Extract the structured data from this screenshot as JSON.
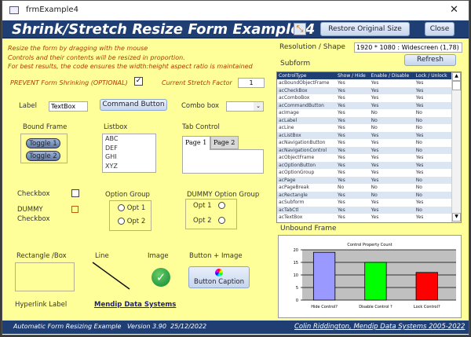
{
  "window": {
    "title": "frmExample4",
    "close_glyph": "✕"
  },
  "header": {
    "title": "Shrink/Stretch Resize Form Example 4",
    "restore_label": "Restore Original Size",
    "close_label": "Close"
  },
  "instructions": [
    "Resize the form by dragging with the mouse",
    "Controls and their contents will be resized in proportion.",
    "For best results, the code ensures the width:height aspect ratio is maintained"
  ],
  "prevent": {
    "label": "PREVENT Form Shrinking (OPTIONAL)",
    "checked": true
  },
  "stretch": {
    "label": "Current Stretch Factor",
    "value": "1"
  },
  "resolution": {
    "label": "Resolution / Shape",
    "value": "1920 * 1080 : Widescreen (1,78)"
  },
  "refresh_label": "Refresh",
  "subform": {
    "label": "Subform",
    "columns": [
      "ControlType",
      "Show / Hide",
      "Enable / Disable",
      "Lock / Unlock"
    ],
    "rows": [
      [
        "acBoundObjectFrame",
        "Yes",
        "Yes",
        "Yes"
      ],
      [
        "acCheckBox",
        "Yes",
        "Yes",
        "Yes"
      ],
      [
        "acComboBox",
        "Yes",
        "Yes",
        "Yes"
      ],
      [
        "acCommandButton",
        "Yes",
        "Yes",
        "Yes"
      ],
      [
        "acImage",
        "Yes",
        "No",
        "No"
      ],
      [
        "acLabel",
        "Yes",
        "No",
        "No"
      ],
      [
        "acLine",
        "Yes",
        "No",
        "No"
      ],
      [
        "acListBox",
        "Yes",
        "Yes",
        "Yes"
      ],
      [
        "acNavigationButton",
        "Yes",
        "Yes",
        "No"
      ],
      [
        "acNavigationControl",
        "Yes",
        "Yes",
        "No"
      ],
      [
        "acObjectFrame",
        "Yes",
        "Yes",
        "Yes"
      ],
      [
        "acOptionButton",
        "Yes",
        "Yes",
        "Yes"
      ],
      [
        "acOptionGroup",
        "Yes",
        "Yes",
        "Yes"
      ],
      [
        "acPage",
        "Yes",
        "Yes",
        "No"
      ],
      [
        "acPageBreak",
        "No",
        "No",
        "No"
      ],
      [
        "acRectangle",
        "Yes",
        "No",
        "No"
      ],
      [
        "acSubform",
        "Yes",
        "Yes",
        "Yes"
      ],
      [
        "acTabCtl",
        "Yes",
        "Yes",
        "No"
      ],
      [
        "acTextBox",
        "Yes",
        "Yes",
        "Yes"
      ]
    ]
  },
  "controls": {
    "label": "Label",
    "textbox": "TextBox",
    "command": "Command Button",
    "combo_label": "Combo box",
    "bound_frame": "Bound Frame",
    "toggle1": "Toggle 1",
    "toggle2": "Toggle 2",
    "listbox_label": "Listbox",
    "listbox_items": [
      "ABC",
      "DEF",
      "GHI",
      "XYZ"
    ],
    "tab_label": "Tab Control",
    "tab1": "Page 1",
    "tab2": "Page 2",
    "checkbox": "Checkbox",
    "dummy_checkbox": "DUMMY Checkbox",
    "option_group": "Option Group",
    "opt1": "Opt 1",
    "opt2": "Opt 2",
    "dummy_option_group": "DUMMY Option Group",
    "rectangle": "Rectangle /Box",
    "line": "Line",
    "image": "Image",
    "button_image": "Button + Image",
    "button_caption": "Button Caption",
    "hyperlink_label": "Hyperlink Label",
    "hyperlink": "Mendip Data Systems"
  },
  "unbound_frame": "Unbound Frame",
  "chart_data": {
    "type": "bar",
    "title": "Control Property Count",
    "categories": [
      "Hide Control?",
      "Disable Control ?",
      "Lock Control?"
    ],
    "values": [
      19,
      15,
      11
    ],
    "colors": [
      "#9999ff",
      "#00ff00",
      "#ff0000"
    ],
    "ylim": [
      0,
      20
    ],
    "yticks": [
      "0",
      "5",
      "10",
      "15",
      "20"
    ],
    "grid": true
  },
  "footer": {
    "left": "Automatic Form Resizing Example   Version 3.90  25/12/2022",
    "right": "Colin Riddington, Mendip Data Systems 2005-2022"
  }
}
